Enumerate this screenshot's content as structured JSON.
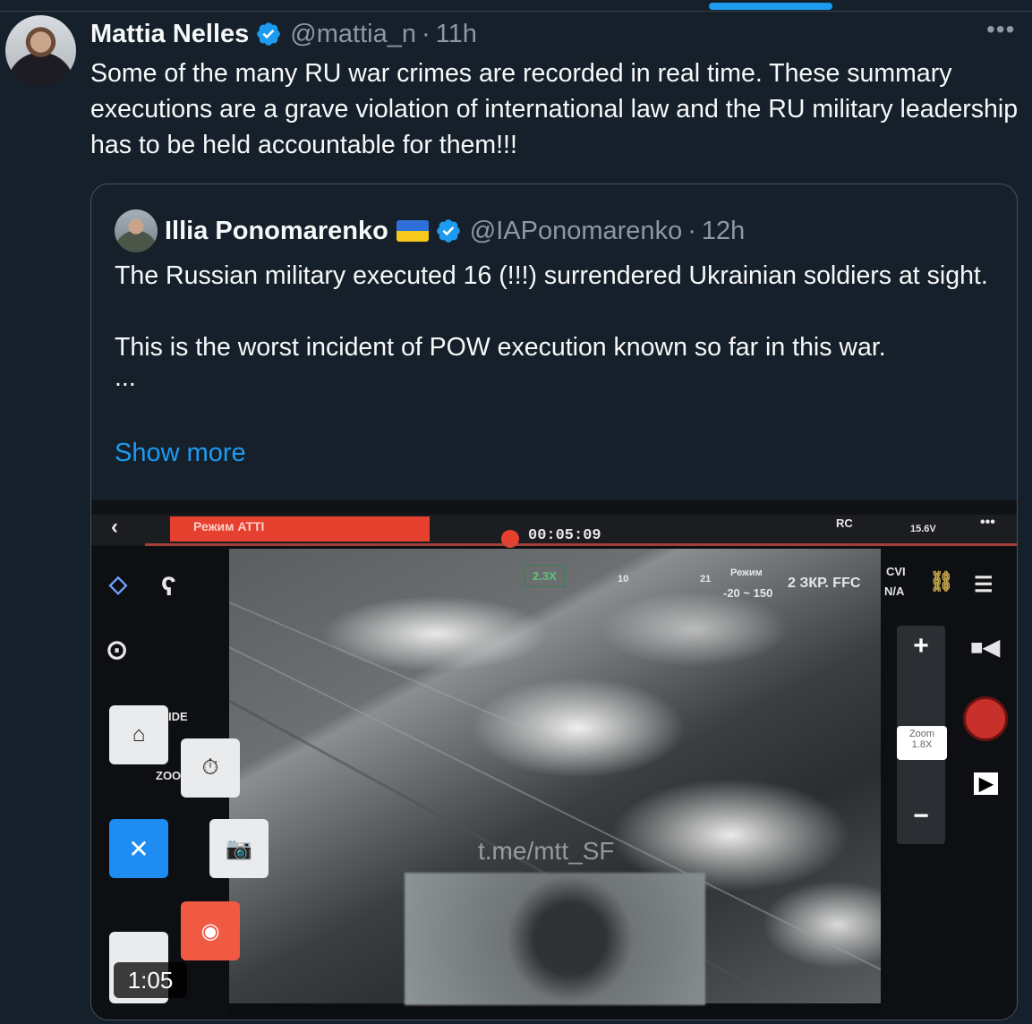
{
  "tweet": {
    "author_name": "Mattia Nelles",
    "author_handle": "@mattia_n",
    "timestamp": "11h",
    "text": "Some of the many RU war crimes are recorded in real time. These summary executions are a grave violation of international law and the RU military leadership has to be held accountable for them!!!",
    "more_icon": "more-horizontal-icon"
  },
  "quote": {
    "author_name": "Illia Ponomarenko",
    "author_handle": "@IAPonomarenko",
    "timestamp": "12h",
    "paragraph_1": "The Russian military executed 16 (!!!) surrendered Ukrainian soldiers at sight.",
    "paragraph_2": "This is the worst incident of POW execution known so far in this war.",
    "ellipsis": "...",
    "show_more": "Show more",
    "flag": "ukraine-flag"
  },
  "video": {
    "duration": "1:05",
    "timer": "00:05:09",
    "mode_label": "Режим ATTI",
    "watermark": "t.me/mtt_SF",
    "overlay": {
      "zoom_indicator": "2.3X",
      "range": "-20 ~ 150",
      "mode": "Режим",
      "ffc": "2 ЗКР.  FFC",
      "cvi": "CVI",
      "na": "N/A",
      "voltage": "15.6V",
      "rc": "RC",
      "zoom_label": "Zoom",
      "zoom_value": "1.8X",
      "left_tab_1": "IDE",
      "left_tab_2": "ZOO",
      "scale_1": "10",
      "scale_2": "21"
    }
  },
  "colors": {
    "background": "#15202b",
    "accent": "#1d9bf0",
    "muted": "#8b98a5",
    "border": "#425364"
  }
}
